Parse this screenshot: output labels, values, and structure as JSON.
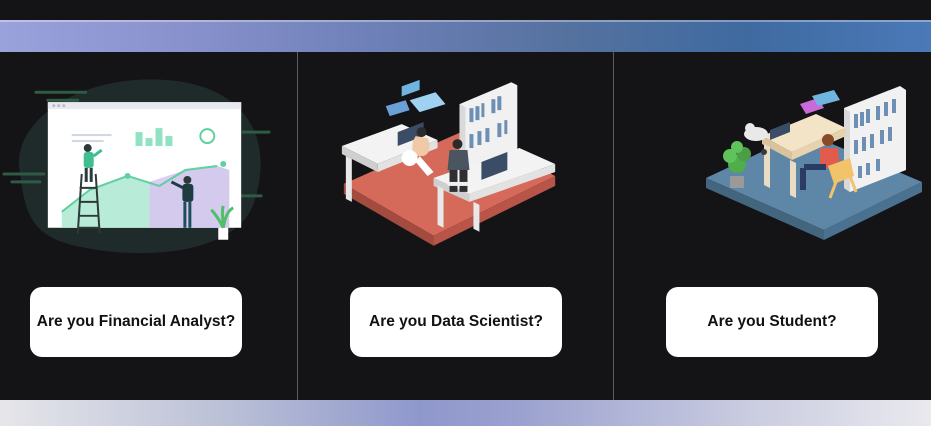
{
  "cards": [
    {
      "label": "Are you Financial Analyst?",
      "illustration": "financial-analyst-illustration"
    },
    {
      "label": "Are you Data Scientist?",
      "illustration": "data-scientist-office-illustration"
    },
    {
      "label": "Are you Student?",
      "illustration": "student-study-room-illustration"
    }
  ],
  "colors": {
    "background": "#141316",
    "card": "#ffffff",
    "divider": "#5c5c66",
    "office_floor": "#d56a5a",
    "student_floor": "#5e86a6",
    "chart_green": "#5fd0a0"
  }
}
